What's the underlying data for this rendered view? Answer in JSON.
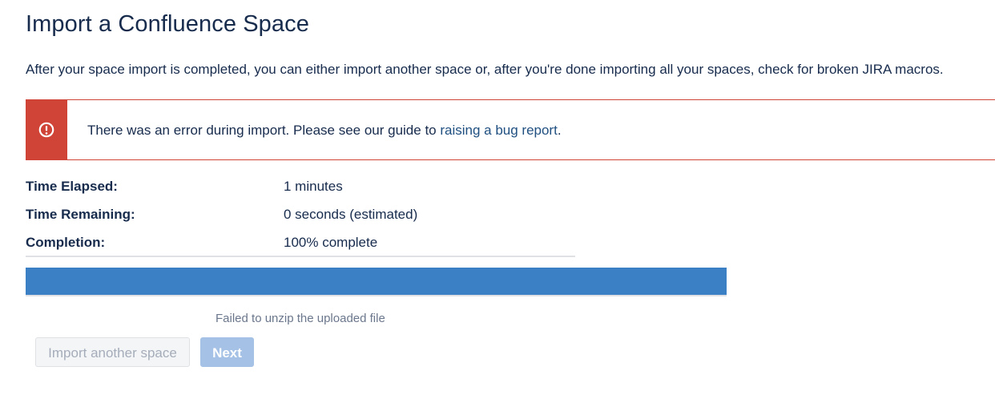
{
  "page": {
    "title": "Import a Confluence Space",
    "intro": "After your space import is completed, you can either import another space or, after you're done importing all your spaces, check for broken JIRA macros."
  },
  "alert": {
    "type": "error",
    "icon": "exclamation-circle-icon",
    "text_before_link": "There was an error during import. Please see our guide to ",
    "link_text": "raising a bug report",
    "text_after_link": ".",
    "color": "#d04437"
  },
  "stats": [
    {
      "label": "Time Elapsed:",
      "value": "1 minutes"
    },
    {
      "label": "Time Remaining:",
      "value": "0 seconds (estimated)"
    },
    {
      "label": "Completion:",
      "value": "100% complete"
    }
  ],
  "progress": {
    "fraction": 1.0,
    "fill_color": "#3b7fc4"
  },
  "status_message": "Failed to unzip the uploaded file",
  "buttons": {
    "import_another": "Import another space",
    "next": "Next"
  }
}
